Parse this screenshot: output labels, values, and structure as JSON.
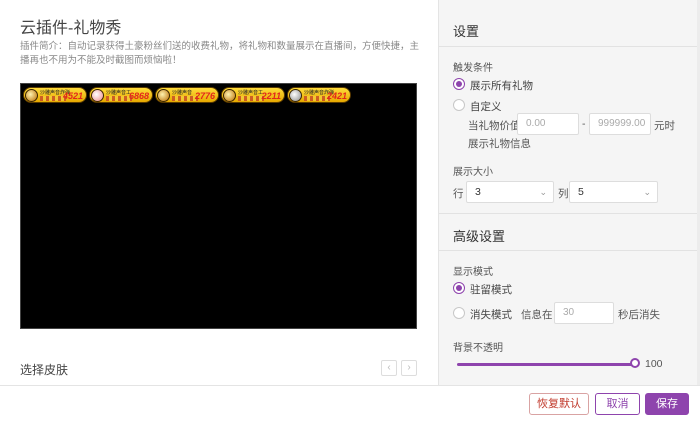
{
  "page": {
    "title": "云插件-礼物秀",
    "description": "插件简介：自动记录获得土豪粉丝们送的收费礼物，将礼物和数量展示在直播间，方便快捷，主播再也不用为不能及时截图而烦恼啦！"
  },
  "preview": {
    "badges": [
      {
        "name": "沙雕声音炸弹",
        "count": "4521",
        "color": "#e6a800"
      },
      {
        "name": "沙雕声音工",
        "count": "6868",
        "color": "#e6a800"
      },
      {
        "name": "沙雕声音",
        "count": "2776",
        "color": "#e6a800"
      },
      {
        "name": "沙雕声音工",
        "count": "2211",
        "color": "#e6a800"
      },
      {
        "name": "沙雕声音炸弹",
        "count": "2421",
        "color": "#e6a800"
      }
    ]
  },
  "skin": {
    "label": "选择皮肤",
    "prev_icon": "chevron-left-icon",
    "next_icon": "chevron-right-icon"
  },
  "settings": {
    "title": "设置",
    "trigger_label": "触发条件",
    "option_all": "展示所有礼物",
    "option_custom": "自定义",
    "value_prefix": "当礼物价值",
    "min_placeholder": "0.00",
    "range_dash": "-",
    "max_placeholder": "999999.00",
    "value_suffix": "元时",
    "show_info": "展示礼物信息",
    "size_label": "展示大小",
    "rows_label": "行",
    "rows_value": "3",
    "cols_label": "列",
    "cols_value": "5"
  },
  "advanced": {
    "title": "高级设置",
    "mode_label": "显示模式",
    "mode_stay": "驻留模式",
    "mode_fade": "消失模式",
    "fade_prefix": "信息在",
    "fade_seconds_placeholder": "30",
    "fade_suffix": "秒后消失",
    "opacity_label": "背景不透明",
    "opacity_value": "100",
    "accent_color": "#8e44ad"
  },
  "footer": {
    "reset": "恢复默认",
    "cancel": "取消",
    "save": "保存"
  }
}
